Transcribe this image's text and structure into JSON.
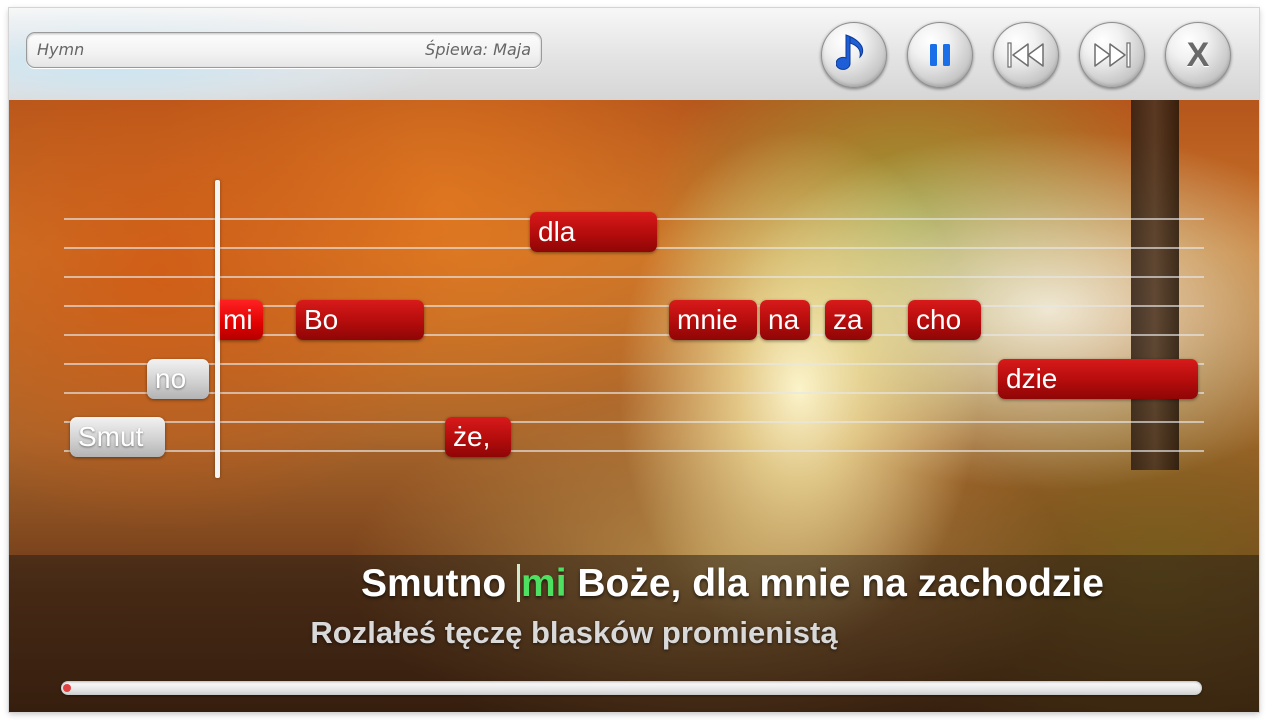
{
  "header": {
    "song_title": "Hymn",
    "singer": "Śpiewa: Maja"
  },
  "controls": [
    {
      "name": "music-note",
      "icon": "music-note-icon"
    },
    {
      "name": "pause",
      "icon": "pause-icon"
    },
    {
      "name": "previous",
      "icon": "skip-back-icon"
    },
    {
      "name": "next",
      "icon": "skip-forward-icon"
    },
    {
      "name": "close",
      "label": "X",
      "icon": "close-icon"
    }
  ],
  "notes": [
    {
      "text": "Smut",
      "state": "sung"
    },
    {
      "text": "no",
      "state": "sung"
    },
    {
      "text": "mi",
      "state": "active"
    },
    {
      "text": "Bo",
      "state": "upcoming"
    },
    {
      "text": "że,",
      "state": "upcoming"
    },
    {
      "text": "dla",
      "state": "upcoming"
    },
    {
      "text": "mnie",
      "state": "upcoming"
    },
    {
      "text": "na",
      "state": "upcoming"
    },
    {
      "text": "za",
      "state": "upcoming"
    },
    {
      "text": "cho",
      "state": "upcoming"
    },
    {
      "text": "dzie",
      "state": "upcoming"
    }
  ],
  "lyrics": {
    "current_before": "Smutno ",
    "current_highlight": "mi",
    "current_after": " Boże, dla mnie na zachodzie",
    "next_line": "Rozlałeś tęczę blasków promienistą"
  },
  "progress": {
    "fraction": 0.003
  },
  "colors": {
    "note_red": "#c41010",
    "note_sung": "#cfcfcf",
    "lyric_highlight": "#4ee060",
    "accent_blue": "#1e5fd8"
  }
}
